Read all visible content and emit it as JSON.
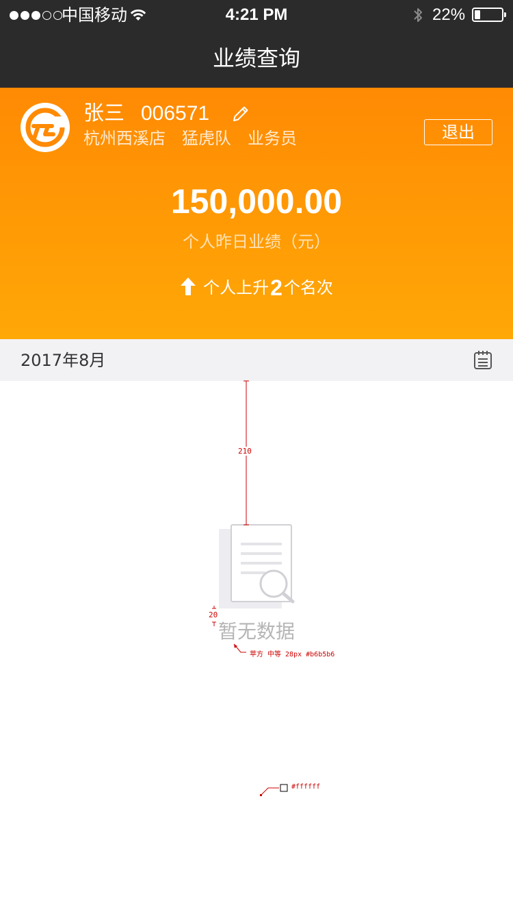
{
  "status_bar": {
    "carrier": "中国移动",
    "time": "4:21 PM",
    "battery_percent": "22%",
    "battery_level": 0.22,
    "signal_bars_filled": 3,
    "signal_bars_total": 5,
    "icons": [
      "signal-dots",
      "wifi-icon",
      "bluetooth-icon",
      "battery-icon"
    ]
  },
  "nav": {
    "title": "业绩查询"
  },
  "profile": {
    "name": "张三",
    "employee_id": "006571",
    "store": "杭州西溪店",
    "team": "猛虎队",
    "role": "业务员",
    "logout_label": "退出",
    "edit_icon": "pencil-icon"
  },
  "performance": {
    "amount": "150,000.00",
    "label": "个人昨日业绩（元）",
    "rank_prefix": "个人上升",
    "rank_change": "2",
    "rank_suffix": "个名次",
    "rank_icon": "arrow-up-icon"
  },
  "month_bar": {
    "month": "2017年8月",
    "calendar_icon": "calendar-icon"
  },
  "empty_state": {
    "text": "暂无数据",
    "illustration": "document-search-icon"
  },
  "annotations": {
    "spacing_label_1": "210",
    "spacing_label_2": "20",
    "font_note": "苹方 中等 28px #b6b5b6",
    "bg_note": "#ffffff"
  },
  "colors": {
    "header_bg": "#2b2b2b",
    "hero_top": "#ff8a04",
    "hero_bottom": "#ffa806",
    "month_bar_bg": "#f2f2f5",
    "empty_text": "#b6b5b6",
    "annotation": "#cc0000"
  }
}
